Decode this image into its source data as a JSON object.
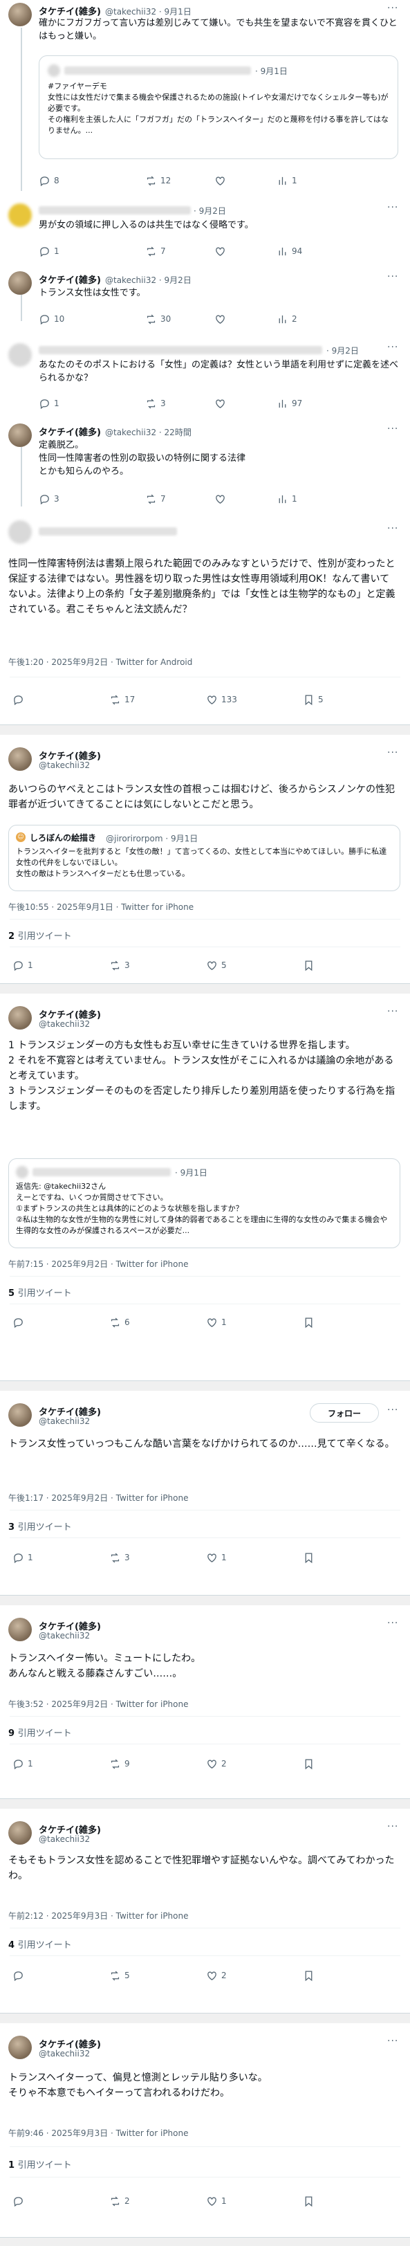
{
  "user": {
    "name": "タケチイ(雑多)",
    "handle": "@takechii32"
  },
  "c1": {
    "head_meta": "@takechii32 · 9月1日",
    "text": "確かにフガフガって言い方は差別じみてて嫌い。でも共生を望まないで不寛容を貫くひとはもっと嫌い。",
    "quote_date": "· 9月1日",
    "quote_text": "#ファイヤーデモ\n女性には女性だけで集まる機会や保護されるための施設(トイレや女湯だけでなくシェルター等も)が必要です。\nその権利を主張した人に「フガフガ」だの「トランスヘイター」だのと蔑称を付ける事を許してはなりません。...",
    "actions": {
      "reply": "8",
      "retweet": "12",
      "like": "",
      "views": "1"
    }
  },
  "c2": {
    "date": "· 9月2日",
    "text": "男が女の領域に押し入るのは共生ではなく侵略です。",
    "actions": {
      "reply": "1",
      "retweet": "7",
      "like": "",
      "views": "94"
    }
  },
  "c3": {
    "head_meta": "@takechii32 · 9月2日",
    "text": "トランス女性は女性です。",
    "actions": {
      "reply": "10",
      "retweet": "30",
      "like": "",
      "views": "2"
    }
  },
  "c4": {
    "date": "· 9月2日",
    "text": "あなたのそのポストにおける「女性」の定義は？女性という単語を利用せずに定義を述べられるかな？",
    "actions": {
      "reply": "1",
      "retweet": "3",
      "like": "",
      "views": "97"
    }
  },
  "c5": {
    "head_meta": "@takechii32 · 22時間",
    "text": "定義脱乙。\n性同一性障害者の性別の取扱いの特例に関する法律\nとかも知らんのやろ。",
    "actions": {
      "reply": "3",
      "retweet": "7",
      "like": "",
      "views": "1"
    }
  },
  "c6": {
    "text": "性同一性障害特例法は書類上限られた範囲でのみみなすというだけで、性別が変わったと保証する法律ではない。男性器を切り取った男性は女性専用領域利用OK！なんて書いてないよ。法律より上の条約「女子差別撤廃条約」では「女性とは生物学的なもの」と定義されている。君こそちゃんと法文読んだ？",
    "time": "午後1:20 · 2025年9月2日 · Twitter for Android",
    "actions": {
      "reply": "",
      "retweet": "17",
      "like": "133",
      "bookmark": "5"
    }
  },
  "t1": {
    "text": "あいつらのヤベえとこはトランス女性の首根っこは掴むけど、後ろからシスノンケの性犯罪者が近づいてきてることには気にしないとこだと思う。",
    "quote_user": "しろぼんの絵描き",
    "quote_meta": "@jirorirorpom · 9月1日",
    "quote_text": "トランスヘイターを批判すると「女性の敵！」て言ってくるの、女性として本当にやめてほしい。勝手に私達女性の代弁をしないでほしい。\n女性の敵はトランスヘイターだとも仕思っている。",
    "time": "午後10:55 · 2025年9月1日 · Twitter for iPhone",
    "quote_count": "2",
    "quote_label": "引用ツイート",
    "actions": {
      "reply": "1",
      "retweet": "3",
      "like": "5",
      "bookmark": ""
    }
  },
  "t2": {
    "text": "1 トランスジェンダーの方も女性もお互い幸せに生きていける世界を指します。\n2 それを不寛容とは考えていません。トランス女性がそこに入れるかは議論の余地があると考えています。\n3 トランスジェンダーそのものを否定したり排斥したり差別用語を使ったりする行為を指します。",
    "quote_date": "· 9月1日",
    "quote_text": "返信先: @takechii32さん\nえーとですね、いくつか質問させて下さい。\n①まずトランスの共生とは具体的にどのような状態を指しますか？\n②私は生物的な女性が生物的な男性に対して身体的弱者であることを理由に生得的な女性のみで集まる機会や生得的な女性のみが保護されるスペースが必要だ...",
    "time": "午前7:15 · 2025年9月2日 · Twitter for iPhone",
    "quote_count": "5",
    "quote_label": "引用ツイート",
    "actions": {
      "reply": "",
      "retweet": "6",
      "like": "1",
      "bookmark": ""
    }
  },
  "t3": {
    "follow": "フォロー",
    "text": "トランス女性っていっつもこんな酷い言葉をなげかけられてるのか……見てて辛くなる。",
    "time": "午後1:17 · 2025年9月2日 · Twitter for iPhone",
    "quote_count": "3",
    "quote_label": "引用ツイート",
    "actions": {
      "reply": "1",
      "retweet": "3",
      "like": "1",
      "bookmark": ""
    }
  },
  "t4": {
    "text": "トランスヘイター怖い。ミュートにしたわ。\nあんなんと戦える藤森さんすごい……。",
    "time": "午後3:52 · 2025年9月2日 · Twitter for iPhone",
    "quote_count": "9",
    "quote_label": "引用ツイート",
    "actions": {
      "reply": "1",
      "retweet": "9",
      "like": "2",
      "bookmark": ""
    }
  },
  "t5": {
    "text": "そもそもトランス女性を認めることで性犯罪増やす証拠ないんやな。調べてみてわかったわ。",
    "time": "午前2:12 · 2025年9月3日 · Twitter for iPhone",
    "quote_count": "4",
    "quote_label": "引用ツイート",
    "actions": {
      "reply": "",
      "retweet": "5",
      "like": "2",
      "bookmark": ""
    }
  },
  "t6": {
    "text": "トランスヘイターって、偏見と憶測とレッテル貼り多いな。\nそりゃ不本意でもヘイターって言われるわけだわ。",
    "time": "午前9:46 · 2025年9月3日 · Twitter for iPhone",
    "quote_count": "1",
    "quote_label": "引用ツイート",
    "actions": {
      "reply": "",
      "retweet": "2",
      "like": "1",
      "bookmark": ""
    }
  }
}
